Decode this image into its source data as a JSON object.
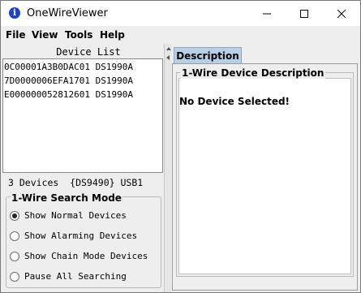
{
  "window": {
    "title": "OneWireViewer"
  },
  "menu": [
    "File",
    "View",
    "Tools",
    "Help"
  ],
  "device_list": {
    "title": "Device List",
    "devices": [
      "0C00001A3B0DAC01 DS1990A",
      "7D0000006EFA1701 DS1990A",
      "E000000052812601 DS1990A"
    ]
  },
  "summary": "3 Devices  {DS9490} USB1",
  "search_mode": {
    "title": "1-Wire Search Mode",
    "options": [
      {
        "label": "Show Normal Devices",
        "selected": true
      },
      {
        "label": "Show Alarming Devices",
        "selected": false
      },
      {
        "label": "Show Chain Mode Devices",
        "selected": false
      },
      {
        "label": "Pause All Searching",
        "selected": false
      }
    ]
  },
  "tabs": [
    {
      "label": "Description",
      "active": true
    }
  ],
  "description": {
    "title": "1-Wire Device Description",
    "message": "No Device Selected!"
  },
  "colors": {
    "tab_active": "#b8cfe5",
    "app_icon": "#1f3fcf"
  },
  "icons": [
    "info-icon",
    "minimize-icon",
    "maximize-icon",
    "close-icon"
  ]
}
